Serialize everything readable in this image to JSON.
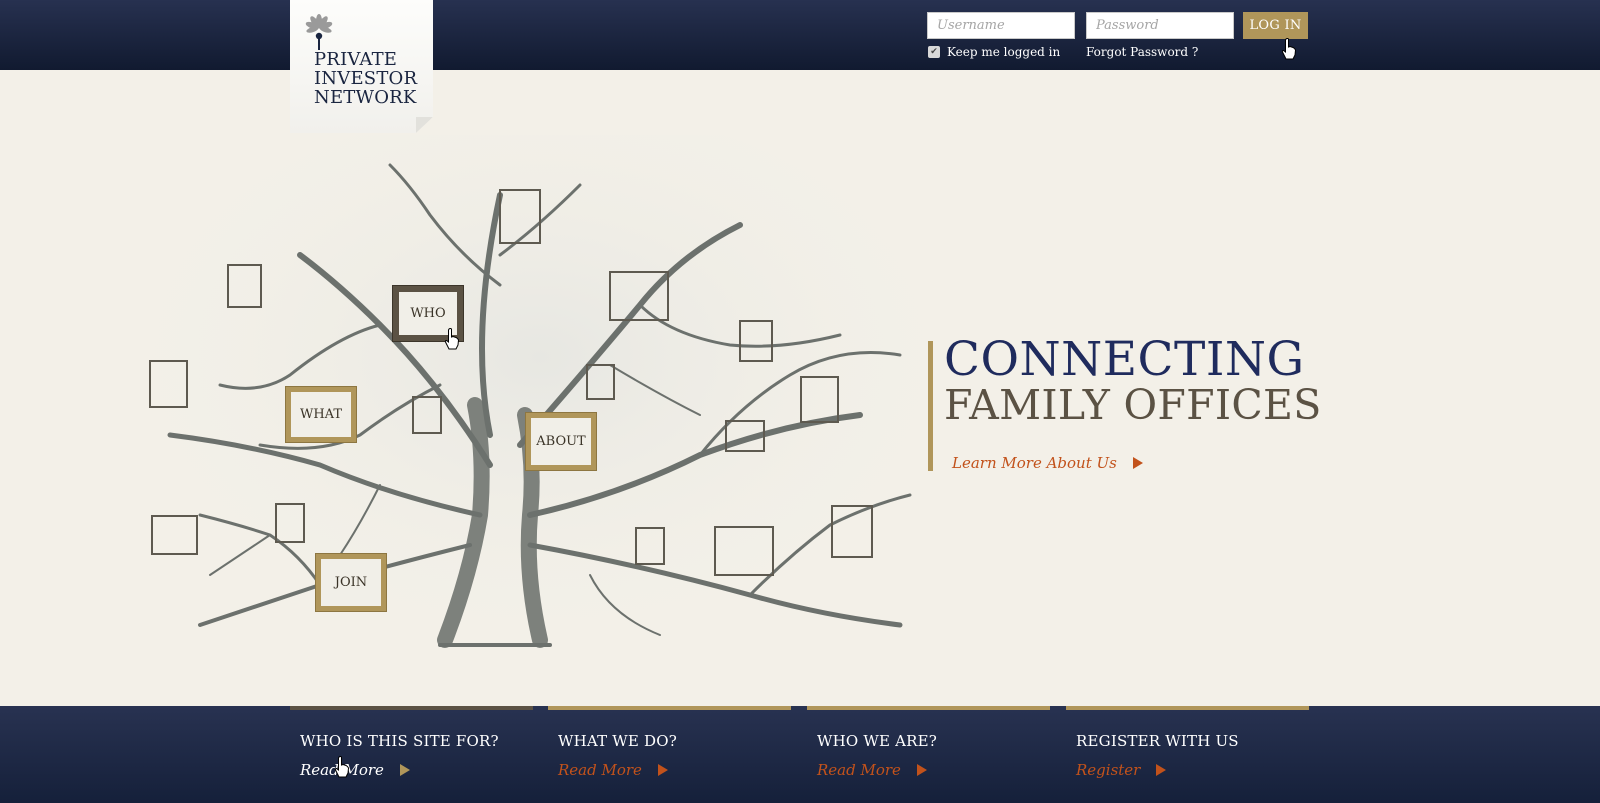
{
  "header": {
    "logo": {
      "lines": [
        "PRIVATE",
        "INVESTOR",
        "NETWORK"
      ]
    },
    "login": {
      "username_placeholder": "Username",
      "password_placeholder": "Password",
      "button_label": "LOG IN",
      "keep_logged_in_label": "Keep me logged in",
      "keep_logged_in_checked": true,
      "forgot_password_label": "Forgot Password ?"
    }
  },
  "hero": {
    "frames": {
      "who": "WHO",
      "what": "WHAT",
      "about": "ABOUT",
      "join": "JOIN"
    },
    "headline_line1": "CONNECTING",
    "headline_line2": "FAMILY OFFICES",
    "learn_more_label": "Learn More About Us"
  },
  "footer_nav": [
    {
      "title": "WHO IS THIS SITE FOR?",
      "link": "Read More"
    },
    {
      "title": "WHAT WE DO?",
      "link": "Read More"
    },
    {
      "title": "WHO WE ARE?",
      "link": "Read More"
    },
    {
      "title": "REGISTER WITH US",
      "link": "Register"
    }
  ],
  "colors": {
    "navy": "#1f2b5d",
    "gold": "#b0965a",
    "brown": "#5b5244",
    "accent_orange": "#c2521b",
    "background": "#f3f0e8"
  }
}
